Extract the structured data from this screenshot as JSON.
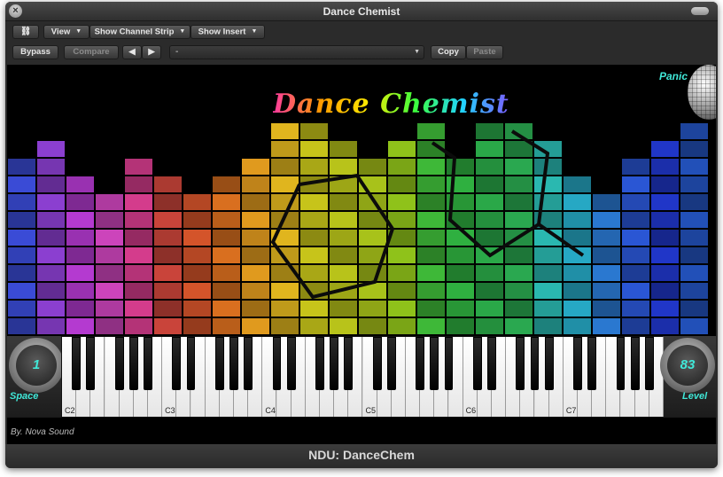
{
  "window": {
    "title": "Dance Chemist"
  },
  "toolbar1": {
    "link_icon": "link-icon",
    "view_label": "View",
    "channel_strip_label": "Show Channel Strip",
    "insert_label": "Show Insert"
  },
  "toolbar2": {
    "bypass_label": "Bypass",
    "compare_label": "Compare",
    "prev_label": "◀",
    "next_label": "▶",
    "preset_value": "-",
    "copy_label": "Copy",
    "paste_label": "Paste"
  },
  "plugin": {
    "logo_text": "Dance Chemist",
    "panic_label": "Panic",
    "space_value": "1",
    "space_label": "Space",
    "level_value": "83",
    "level_label": "Level",
    "credit": "By. Nova Sound",
    "key_labels": [
      "C2",
      "C3",
      "C4",
      "C5",
      "C6",
      "C7"
    ]
  },
  "footer": {
    "title": "NDU: DanceChem"
  },
  "colors": {
    "accent_teal": "#40e8d8",
    "window_bg": "#2b2b2b"
  }
}
